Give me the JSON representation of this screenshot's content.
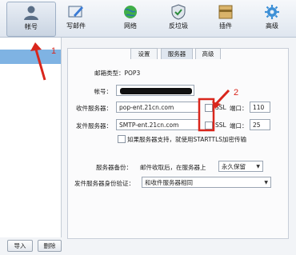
{
  "toolbar": {
    "items": [
      {
        "label": "帐号",
        "icon": "account-icon"
      },
      {
        "label": "写邮件",
        "icon": "compose-icon"
      },
      {
        "label": "网络",
        "icon": "network-icon"
      },
      {
        "label": "反垃圾",
        "icon": "antispam-icon"
      },
      {
        "label": "插件",
        "icon": "plugin-icon"
      },
      {
        "label": "高级",
        "icon": "advanced-gear-icon"
      }
    ]
  },
  "tabs": [
    "设置",
    "服务器",
    "高级"
  ],
  "form": {
    "mailbox_type": "邮箱类型：POP3",
    "account_label": "帐号：",
    "incoming_label": "收件服务器：",
    "incoming_value": "pop-ent.21cn.com",
    "outgoing_label": "发件服务器：",
    "outgoing_value": "SMTP-ent.21cn.com",
    "ssl_label": "SSL",
    "port_label": "端口：",
    "incoming_port": "110",
    "outgoing_port": "25",
    "starttls_label": "如果服务器支持，就使用STARTTLS加密传输",
    "backup_label": "服务器备份：",
    "backup_desc": "邮件收取后，在服务器上",
    "backup_value": "永久保留",
    "auth_label": "发件服务器身份验证：",
    "auth_value": "和收件服务器相同"
  },
  "bottom_buttons": [
    "导入",
    "删除"
  ],
  "annotations": [
    "1",
    "2"
  ],
  "colors": {
    "annotation": "#d9261c",
    "selected_row": "#7fb3e3"
  }
}
